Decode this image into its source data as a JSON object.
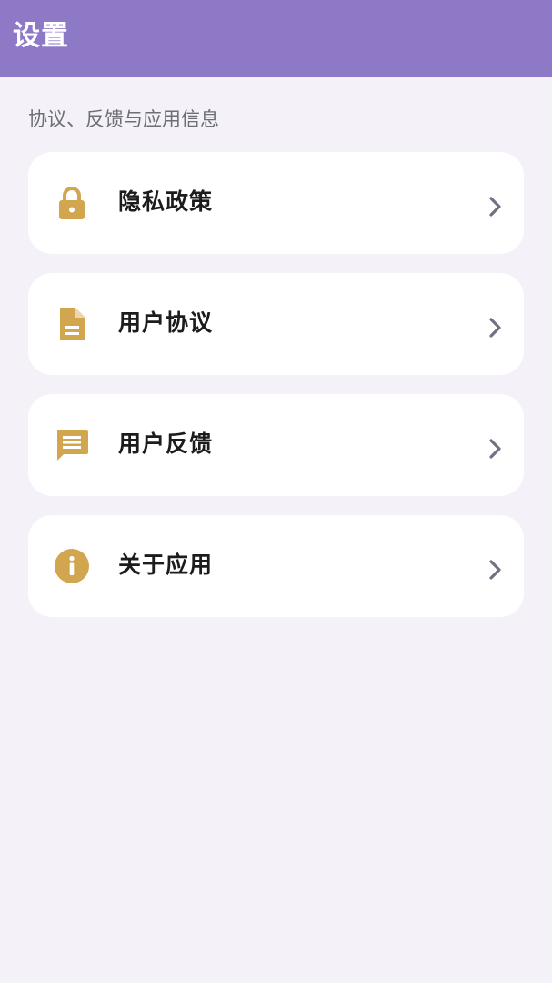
{
  "header": {
    "title": "设置"
  },
  "section": {
    "title": "协议、反馈与应用信息"
  },
  "items": [
    {
      "label": "隐私政策",
      "icon": "lock-icon"
    },
    {
      "label": "用户协议",
      "icon": "document-icon"
    },
    {
      "label": "用户反馈",
      "icon": "message-icon"
    },
    {
      "label": "关于应用",
      "icon": "info-icon"
    }
  ],
  "colors": {
    "header_bg": "#8e79c7",
    "page_bg": "#f4f1f8",
    "icon_gold": "#d1a64e",
    "chevron": "#6f7280"
  }
}
